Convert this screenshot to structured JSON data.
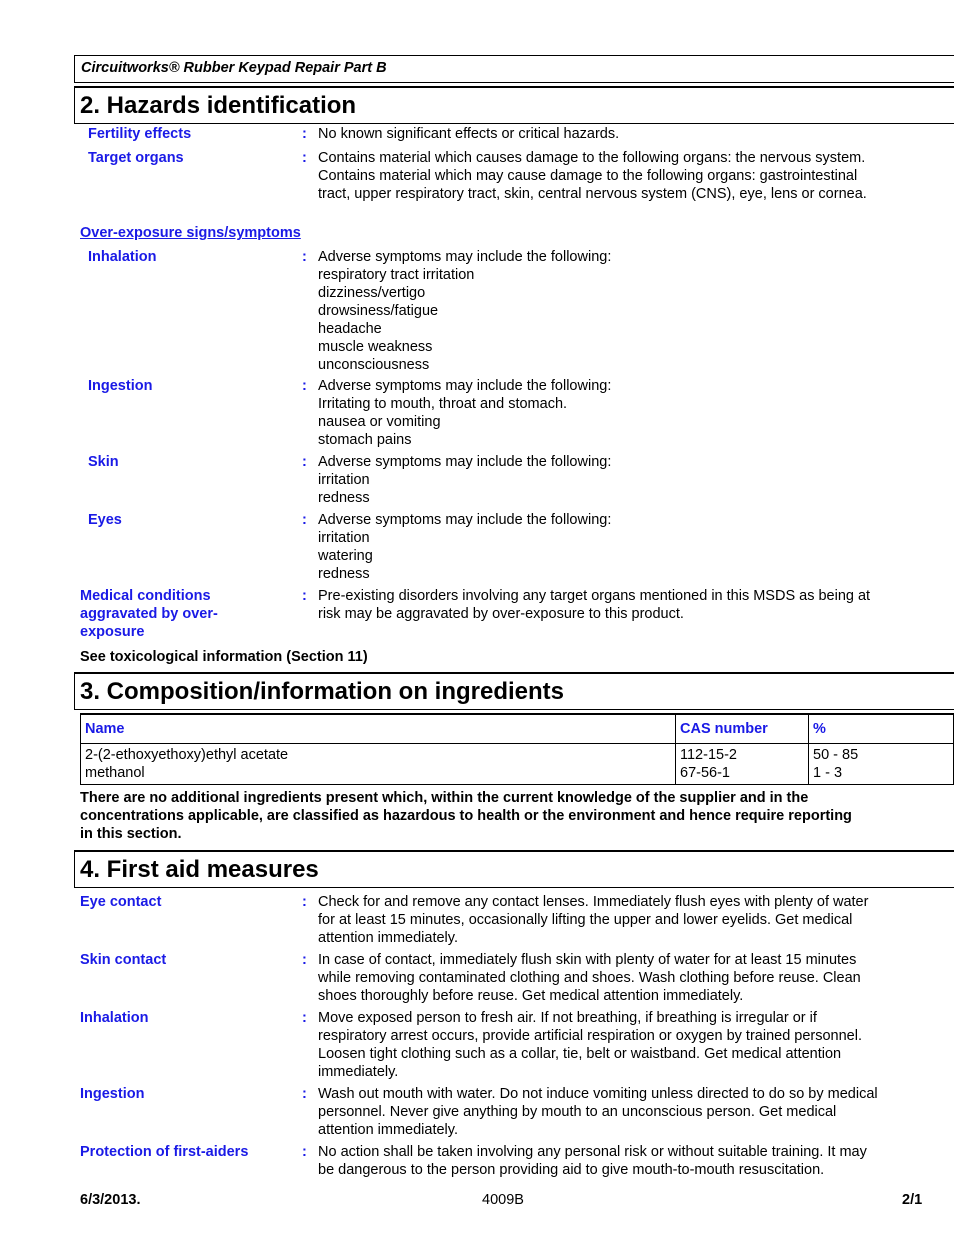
{
  "header": {
    "product_name": "Circuitworks® Rubber Keypad Repair Part B"
  },
  "section2": {
    "title": "2. Hazards identification",
    "items_top": [
      {
        "label": "Fertility effects",
        "lines": [
          "No known significant effects or critical hazards."
        ]
      },
      {
        "label": "Target organs",
        "lines": [
          "Contains material which causes damage to the following organs: the nervous system.",
          "Contains material which may cause damage to the following organs: gastrointestinal",
          "tract, upper respiratory tract, skin, central nervous system (CNS), eye, lens or cornea."
        ]
      }
    ],
    "overexposure_heading": "Over-exposure signs/symptoms",
    "overexposure": [
      {
        "label": "Inhalation",
        "lines": [
          "Adverse symptoms may include the following:",
          "respiratory tract irritation",
          "dizziness/vertigo",
          "drowsiness/fatigue",
          "headache",
          "muscle weakness",
          "unconsciousness"
        ]
      },
      {
        "label": "Ingestion",
        "lines": [
          "Adverse symptoms may include the following:",
          "Irritating to mouth, throat and stomach.",
          "nausea or vomiting",
          "stomach pains"
        ]
      },
      {
        "label": "Skin",
        "lines": [
          "Adverse symptoms may include the following:",
          "irritation",
          "redness"
        ]
      },
      {
        "label": "Eyes",
        "lines": [
          "Adverse symptoms may include the following:",
          "irritation",
          "watering",
          "redness"
        ]
      }
    ],
    "medical_conditions": {
      "label_lines": [
        "Medical conditions",
        "aggravated by over-",
        "exposure"
      ],
      "lines": [
        "Pre-existing disorders involving any target organs mentioned in this MSDS as being at",
        "risk may be aggravated by over-exposure to this product."
      ]
    },
    "see_tox": "See toxicological information (Section 11)"
  },
  "section3": {
    "title": "3. Composition/information on ingredients",
    "columns": [
      "Name",
      "CAS number",
      "%"
    ],
    "rows": [
      {
        "name": "2-(2-ethoxyethoxy)ethyl acetate",
        "cas": "112-15-2",
        "percent": "50 - 85"
      },
      {
        "name": "methanol",
        "cas": "67-56-1",
        "percent": "1 - 3"
      }
    ],
    "note_lines": [
      "There are no additional ingredients present which, within the current knowledge of the supplier and in the",
      "concentrations applicable, are classified as hazardous to health or the environment and hence require reporting",
      "in this section."
    ]
  },
  "section4": {
    "title": "4. First aid measures",
    "items": [
      {
        "label": "Eye contact",
        "lines": [
          "Check for and remove any contact lenses.  Immediately flush eyes with plenty of water",
          "for at least 15 minutes, occasionally lifting the upper and lower eyelids.  Get medical",
          "attention immediately."
        ]
      },
      {
        "label": "Skin contact",
        "lines": [
          "In case of contact, immediately flush skin with plenty of water for at least 15 minutes",
          "while removing contaminated clothing and shoes.  Wash clothing before reuse.  Clean",
          "shoes thoroughly before reuse.  Get medical attention immediately."
        ]
      },
      {
        "label": "Inhalation",
        "lines": [
          "Move exposed person to fresh air.  If not breathing, if breathing is irregular or if",
          "respiratory arrest occurs, provide artificial respiration or oxygen by trained personnel.",
          "Loosen tight clothing such as a collar, tie, belt or waistband.  Get medical attention",
          "immediately."
        ]
      },
      {
        "label": "Ingestion",
        "lines": [
          "Wash out mouth with water.  Do not induce vomiting unless directed to do so by medical",
          "personnel.  Never give anything by mouth to an unconscious person.  Get medical",
          "attention immediately."
        ]
      },
      {
        "label": "Protection of first-aiders",
        "lines": [
          "No action shall be taken involving any personal risk or without suitable training.  It may",
          "be dangerous to the person providing aid to give mouth-to-mouth resuscitation."
        ]
      }
    ]
  },
  "footer": {
    "date": "6/3/2013.",
    "code": "4009B",
    "page": "2/1"
  },
  "colors": {
    "label_blue": "#1a1ae6",
    "text": "#000000"
  },
  "colon": ":"
}
